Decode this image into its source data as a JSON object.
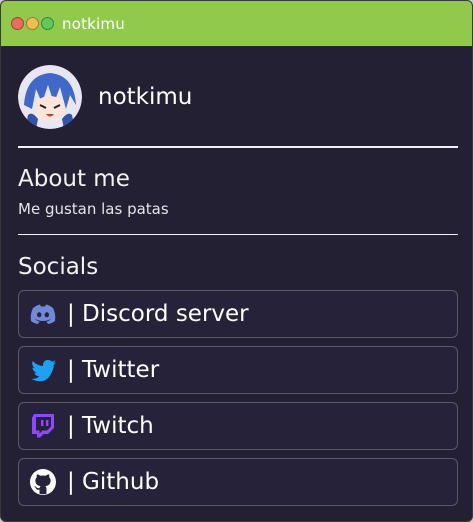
{
  "window": {
    "title": "notkimu"
  },
  "profile": {
    "username": "notkimu",
    "avatar_icon": "avatar-image"
  },
  "about": {
    "heading": "About me",
    "text": "Me gustan las patas"
  },
  "socials": {
    "heading": "Socials",
    "items": [
      {
        "label": "| Discord server",
        "icon": "discord-icon",
        "color": "#7289da"
      },
      {
        "label": "| Twitter",
        "icon": "twitter-icon",
        "color": "#1da1f2"
      },
      {
        "label": "| Twitch",
        "icon": "twitch-icon",
        "color": "#9146ff"
      },
      {
        "label": "| Github",
        "icon": "github-icon",
        "color": "#ffffff"
      }
    ]
  },
  "colors": {
    "titlebar": "#91c94d",
    "background": "#242033"
  }
}
